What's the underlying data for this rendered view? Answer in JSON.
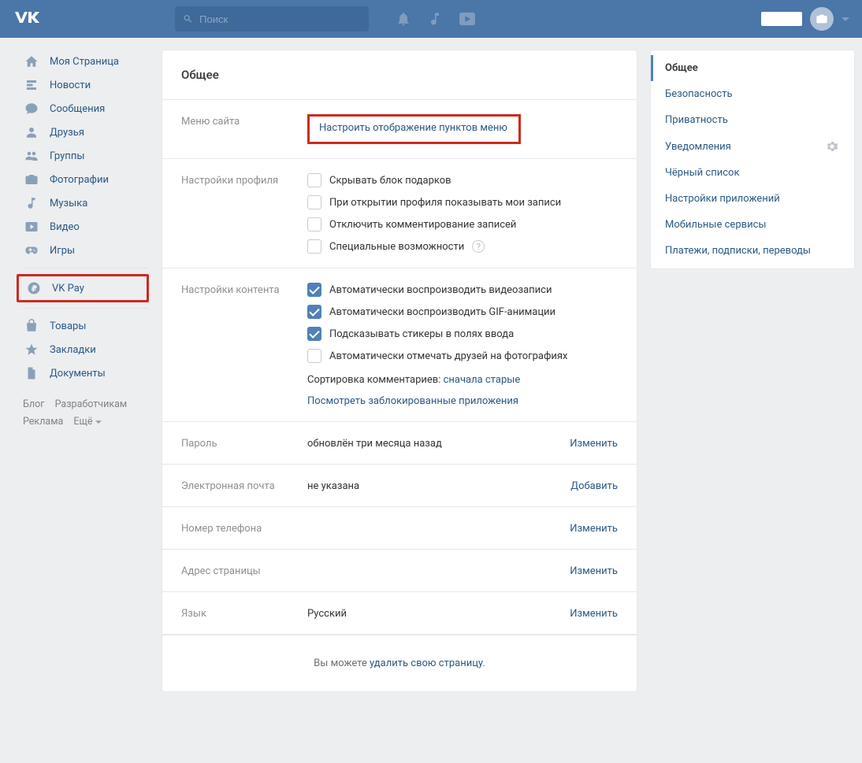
{
  "header": {
    "search_placeholder": "Поиск"
  },
  "nav": {
    "items": [
      {
        "key": "my-page",
        "label": "Моя Страница"
      },
      {
        "key": "news",
        "label": "Новости"
      },
      {
        "key": "messages",
        "label": "Сообщения"
      },
      {
        "key": "friends",
        "label": "Друзья"
      },
      {
        "key": "groups",
        "label": "Группы"
      },
      {
        "key": "photos",
        "label": "Фотографии"
      },
      {
        "key": "music",
        "label": "Музыка"
      },
      {
        "key": "video",
        "label": "Видео"
      },
      {
        "key": "games",
        "label": "Игры"
      }
    ],
    "vkpay": {
      "key": "vkpay",
      "label": "VK Pay"
    },
    "items2": [
      {
        "key": "market",
        "label": "Товары"
      },
      {
        "key": "bookmarks",
        "label": "Закладки"
      },
      {
        "key": "docs",
        "label": "Документы"
      }
    ],
    "footer": {
      "blog": "Блог",
      "devs": "Разработчикам",
      "ads": "Реклама",
      "more": "Ещё"
    }
  },
  "subnav": {
    "items": [
      "Общее",
      "Безопасность",
      "Приватность",
      "Уведомления",
      "Чёрный список",
      "Настройки приложений",
      "Мобильные сервисы",
      "Платежи, подписки, переводы"
    ]
  },
  "settings": {
    "title": "Общее",
    "menu": {
      "label": "Меню сайта",
      "link": "Настроить отображение пунктов меню"
    },
    "profile": {
      "label": "Настройки профиля",
      "opts": [
        {
          "text": "Скрывать блок подарков",
          "checked": false
        },
        {
          "text": "При открытии профиля показывать мои записи",
          "checked": false
        },
        {
          "text": "Отключить комментирование записей",
          "checked": false
        },
        {
          "text": "Специальные возможности",
          "checked": false,
          "help": true
        }
      ]
    },
    "content": {
      "label": "Настройки контента",
      "opts": [
        {
          "text": "Автоматически воспроизводить видеозаписи",
          "checked": true
        },
        {
          "text": "Автоматически воспроизводить GIF-анимации",
          "checked": true
        },
        {
          "text": "Подсказывать стикеры в полях ввода",
          "checked": true
        },
        {
          "text": "Автоматически отмечать друзей на фотографиях",
          "checked": false
        }
      ],
      "sort_label": "Сортировка комментариев: ",
      "sort_value": "сначала старые",
      "blocked_link": "Посмотреть заблокированные приложения"
    },
    "password": {
      "label": "Пароль",
      "value": "обновлён три месяца назад",
      "action": "Изменить"
    },
    "email": {
      "label": "Электронная почта",
      "value": "не указана",
      "action": "Добавить"
    },
    "phone": {
      "label": "Номер телефона",
      "value": "",
      "action": "Изменить"
    },
    "address": {
      "label": "Адрес страницы",
      "value": "",
      "action": "Изменить"
    },
    "lang": {
      "label": "Язык",
      "value": "Русский",
      "action": "Изменить"
    },
    "delete": {
      "prefix": "Вы можете ",
      "link": "удалить свою страницу",
      "suffix": "."
    }
  }
}
